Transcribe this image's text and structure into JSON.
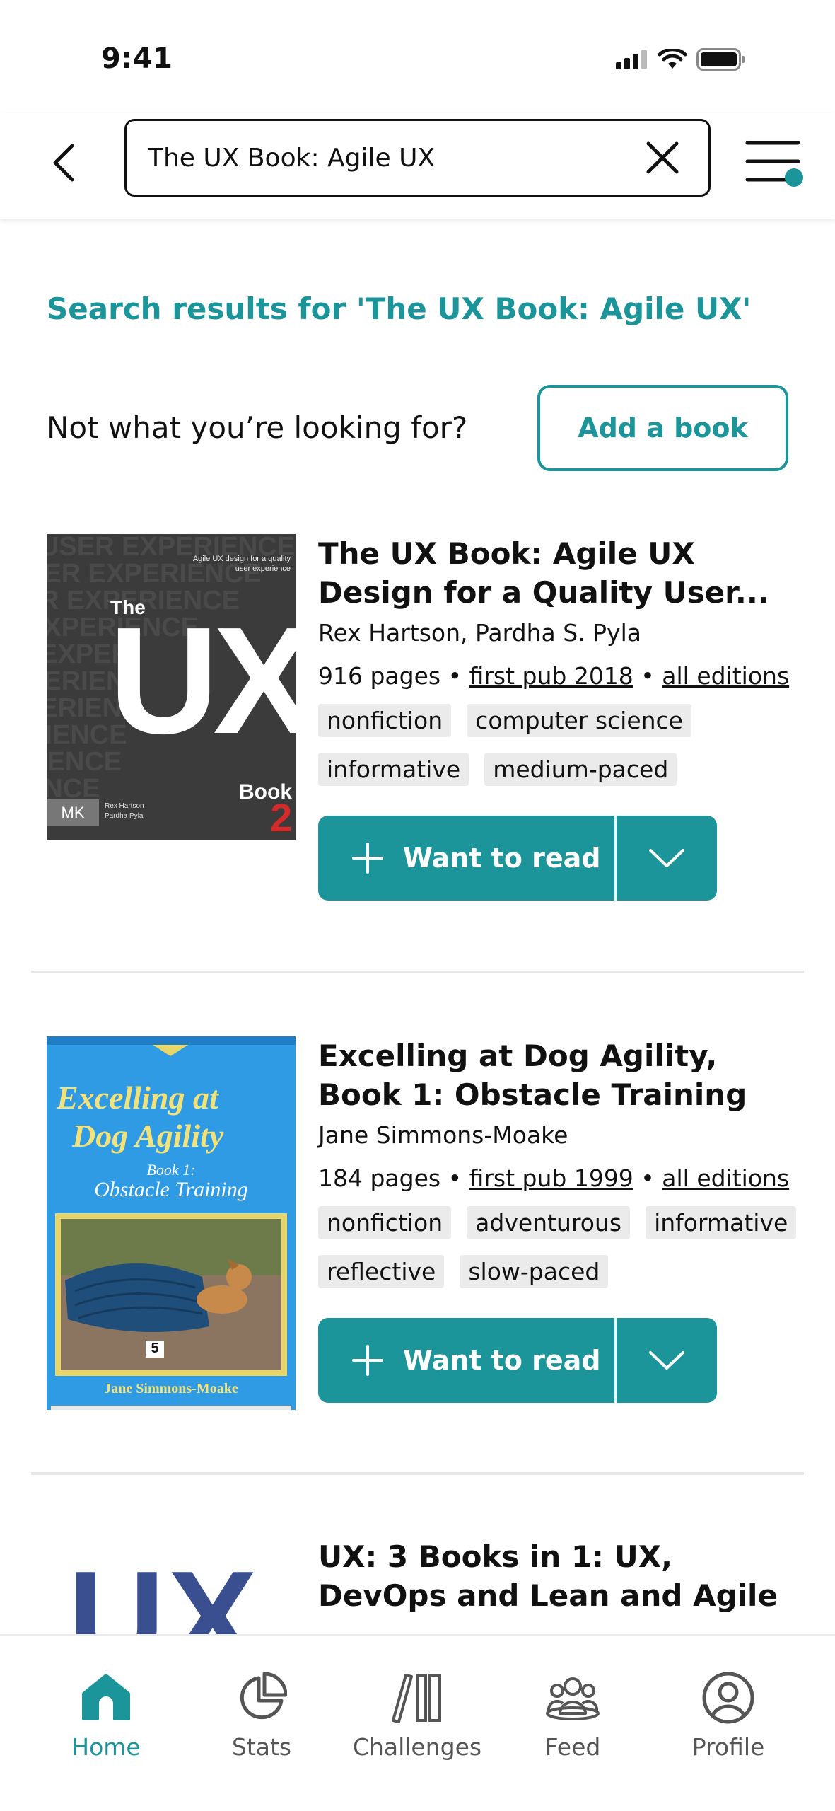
{
  "status": {
    "time": "9:41"
  },
  "search": {
    "query": "The UX Book: Agile UX"
  },
  "results": {
    "title": "Search results for 'The UX Book: Agile UX'",
    "not_found_prompt": "Not what you’re looking for?",
    "add_book_label": "Add a book"
  },
  "books": [
    {
      "title": "The UX Book: Agile UX Design for a Quality User...",
      "authors": "Rex Hartson, Pardha S. Pyla",
      "pages": "916 pages",
      "bullet1": " • ",
      "first_pub": "first pub 2018",
      "bullet2": " • ",
      "editions": "all editions",
      "tags": [
        "nonfiction",
        "computer science",
        "informative",
        "medium-paced"
      ],
      "want_label": "Want to read",
      "cover": {
        "tagline": "Agile UX design for a quality user experience",
        "word_the": "The",
        "word_ux": "UX",
        "word_book": "Book",
        "edition": "2",
        "publisher": "MK",
        "authors_small": "Rex Hartson Pardha Pyla"
      }
    },
    {
      "title": "Excelling at Dog Agility, Book 1: Obstacle Training",
      "authors": "Jane Simmons-Moake",
      "pages": "184 pages",
      "bullet1": " • ",
      "first_pub": "first pub 1999",
      "bullet2": " • ",
      "editions": "all editions",
      "tags": [
        "nonfiction",
        "adventurous",
        "informative",
        "reflective",
        "slow-paced"
      ],
      "want_label": "Want to read",
      "cover": {
        "title_line1": "Excelling at",
        "title_line2": "Dog Agility",
        "subtitle1": "Book 1:",
        "subtitle2": "Obstacle Training",
        "author": "Jane Simmons-Moake",
        "number": "5"
      }
    },
    {
      "title": "UX: 3 Books in 1: UX, DevOps and Lean and Agile",
      "cover": {
        "word_ux": "UX"
      }
    }
  ],
  "tabs": [
    {
      "label": "Home",
      "icon": "home-icon",
      "active": true
    },
    {
      "label": "Stats",
      "icon": "pie-chart-icon",
      "active": false
    },
    {
      "label": "Challenges",
      "icon": "books-shelf-icon",
      "active": false
    },
    {
      "label": "Feed",
      "icon": "people-icon",
      "active": false
    },
    {
      "label": "Profile",
      "icon": "user-circle-icon",
      "active": false
    }
  ],
  "colors": {
    "accent": "#1b9599",
    "text": "#111111",
    "tag_bg": "#ebebeb"
  }
}
